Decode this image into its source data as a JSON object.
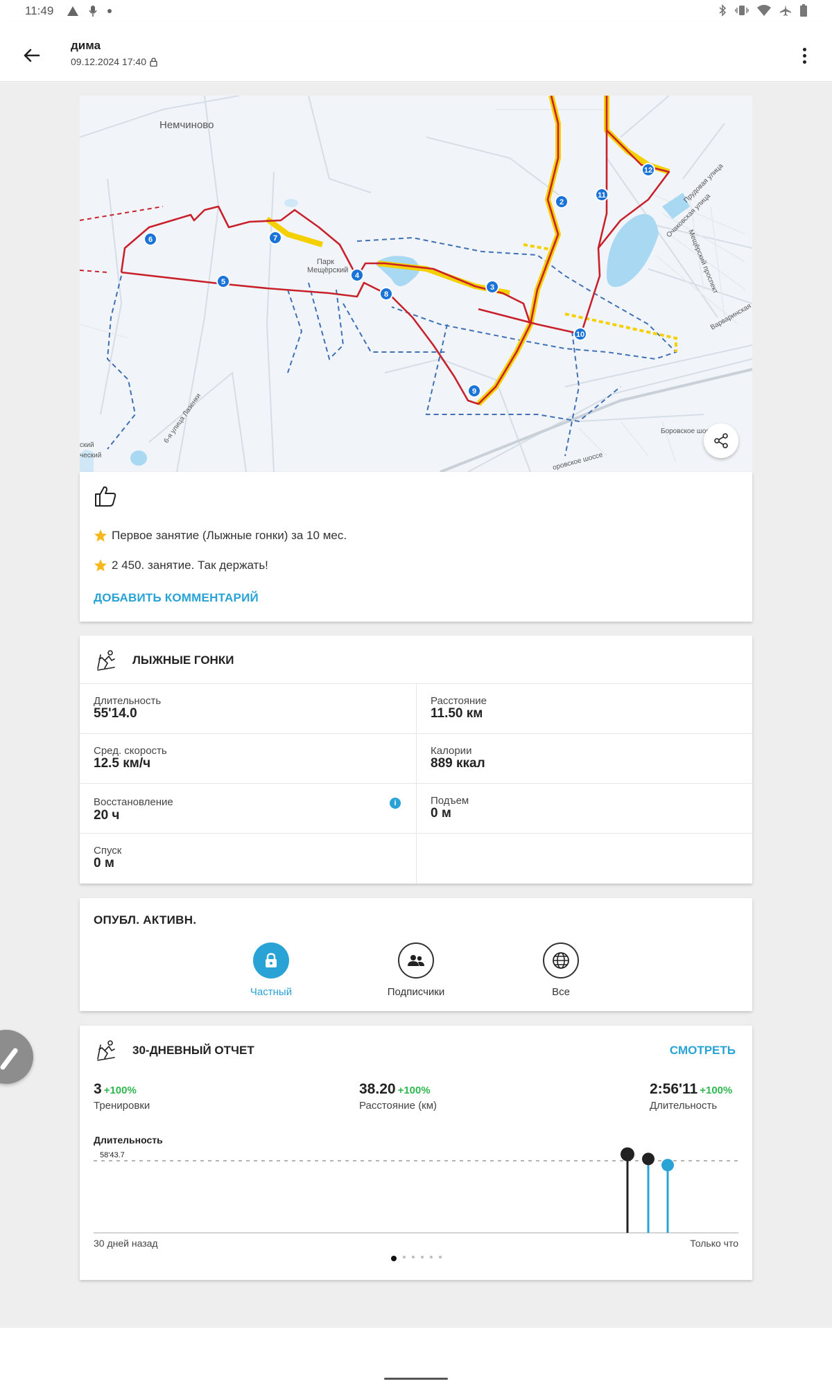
{
  "status_bar": {
    "time": "11:49",
    "left_icons": [
      "warning-triangle-icon",
      "microphone-icon",
      "notification-dot-icon"
    ],
    "right_icons": [
      "bluetooth-icon",
      "vibrate-icon",
      "wifi-icon",
      "airplane-icon",
      "battery-icon"
    ]
  },
  "app_bar": {
    "title": "дима",
    "subtitle": "09.12.2024 17:40",
    "back_icon": "arrow-left-icon",
    "menu_icon": "more-vert-icon"
  },
  "map": {
    "place_labels": [
      "Немчиново",
      "Парк Мещёрский",
      "Прудовая улица",
      "Очаковская улица",
      "Мещёрский проспект",
      "Варваринская",
      "Боровское шоссе",
      "6-я улица Лазенки",
      "ский",
      "ческий",
      "оровское шоссе"
    ],
    "lap_markers": [
      "2",
      "3",
      "4",
      "5",
      "6",
      "7",
      "8",
      "9",
      "10",
      "11",
      "12"
    ],
    "share_icon": "share-icon"
  },
  "reactions": {
    "like_icon": "thumbs-up-icon",
    "achievements": [
      "Первое занятие (Лыжные гонки) за 10 мес.",
      "2 450. занятие. Так держать!"
    ],
    "add_comment": "ДОБАВИТЬ КОММЕНТАРИЙ"
  },
  "activity": {
    "title": "ЛЫЖНЫЕ ГОНКИ",
    "stats": [
      {
        "label": "Длительность",
        "value": "55'14.0"
      },
      {
        "label": "Расстояние",
        "value": "11.50 км"
      },
      {
        "label": "Сред. скорость",
        "value": "12.5 км/ч"
      },
      {
        "label": "Калории",
        "value": "889 ккал"
      },
      {
        "label": "Восстановление",
        "value": "20 ч"
      },
      {
        "label": "Подъем",
        "value": "0 м"
      },
      {
        "label": "Спуск",
        "value": "0 м"
      }
    ],
    "info_mark": "i"
  },
  "publish": {
    "title": "ОПУБЛ. АКТИВН.",
    "options": [
      {
        "label": "Частный",
        "icon": "lock-icon",
        "selected": true
      },
      {
        "label": "Подписчики",
        "icon": "followers-icon",
        "selected": false
      },
      {
        "label": "Все",
        "icon": "globe-icon",
        "selected": false
      }
    ]
  },
  "report": {
    "title": "30-ДНЕВНЫЙ ОТЧЕТ",
    "view_link": "СМОТРЕТЬ",
    "summary": [
      {
        "value": "3",
        "change": "+100%",
        "label": "Тренировки"
      },
      {
        "value": "38.20",
        "change": "+100%",
        "label": "Расстояние (км)"
      },
      {
        "value": "2:56'11",
        "change": "+100%",
        "label": "Длительность"
      }
    ],
    "chart_label": "Длительность",
    "axis_start": "30 дней назад",
    "axis_end": "Только что",
    "page_count": 6,
    "page_active": 0
  },
  "chart_data": {
    "type": "bar",
    "title": "Длительность",
    "xlabel": "",
    "ylabel": "",
    "reference_line": {
      "label": "58'43.7",
      "value_min": 58.73
    },
    "categories": [
      "",
      "",
      ""
    ],
    "series": [
      {
        "values_min": [
          64.0,
          60.2,
          55.2
        ]
      }
    ],
    "bar_colors": [
      "#222222",
      "#29a3d6",
      "#29a3d6"
    ],
    "head_colors": [
      "#222222",
      "#222222",
      "#29a3d6"
    ],
    "ylim_min": [
      0,
      70
    ],
    "x_range": [
      "30 дней назад",
      "Только что"
    ]
  },
  "colors": {
    "accent": "#29a3d6",
    "positive": "#2fb84f",
    "route": "#c8212b",
    "route_highlight": "#f5d000"
  }
}
